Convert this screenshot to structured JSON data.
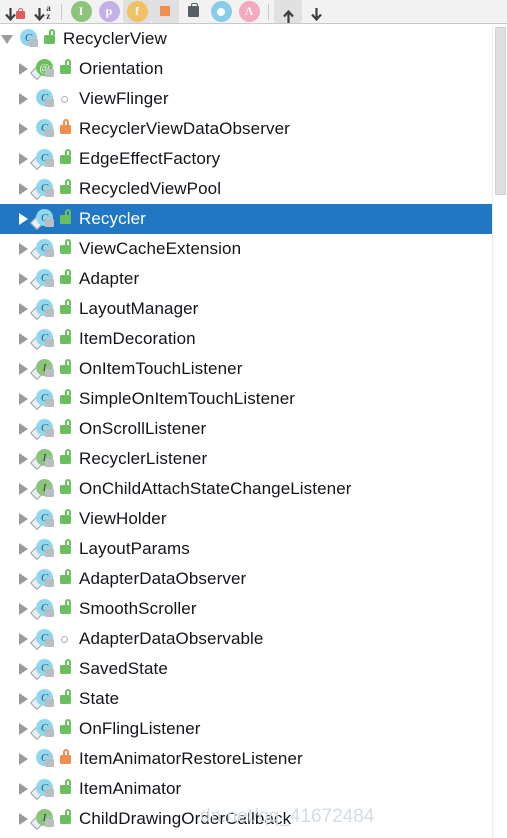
{
  "toolbar": {
    "buttons": [
      {
        "name": "sort-by-visibility-button",
        "icon": "arrow-down-lock-icon",
        "glyph": "lock",
        "pressed": false
      },
      {
        "name": "sort-alphabetically-button",
        "icon": "arrow-down-az-icon",
        "glyph": "az",
        "pressed": false
      },
      {
        "name": "show-inherited-button",
        "icon": "inherited-members-icon",
        "glyph": "I",
        "color": "#8cc47c",
        "pressed": false
      },
      {
        "name": "show-properties-button",
        "icon": "properties-icon",
        "glyph": "p",
        "color": "#c3b0e8",
        "pressed": false
      },
      {
        "name": "show-fields-button",
        "icon": "fields-icon",
        "glyph": "f",
        "color": "#f0c064",
        "pressed": true
      },
      {
        "name": "show-constants-button",
        "icon": "constants-icon",
        "glyph": "square",
        "color": "#ef8e4e",
        "pressed": true
      },
      {
        "name": "show-non-public-button",
        "icon": "briefcase-icon",
        "glyph": "briefcase",
        "pressed": false
      },
      {
        "name": "group-methods-button",
        "icon": "circle-o-icon",
        "glyph": "O",
        "color": "#87cde8",
        "pressed": false
      },
      {
        "name": "show-anonymous-button",
        "icon": "lambda-icon",
        "glyph": "Λ",
        "color": "#f3aabc",
        "pressed": false
      },
      {
        "name": "expand-all-button",
        "icon": "arrow-up-icon",
        "glyph": "up",
        "pressed": true
      },
      {
        "name": "collapse-all-button",
        "icon": "arrow-down-icon",
        "glyph": "down",
        "pressed": false
      }
    ]
  },
  "colors": {
    "selection": "#2277c4",
    "toolbar_bg": "#f2f2f2",
    "class_badge": "#8fd8ef",
    "interface_badge": "#8cc47c",
    "annotation_badge": "#6cbf5e",
    "protected_lock": "#6cbf5e",
    "private_lock": "#ef8e4e",
    "text": "#12141a"
  },
  "tree": {
    "nodes": [
      {
        "label": "RecyclerView",
        "kind": "class",
        "abstract": false,
        "visibility": "protected",
        "depth": 0,
        "expanded": true,
        "selected": false
      },
      {
        "label": "Orientation",
        "kind": "annotation",
        "abstract": true,
        "visibility": "protected",
        "depth": 1,
        "expanded": false,
        "selected": false
      },
      {
        "label": "ViewFlinger",
        "kind": "class",
        "abstract": false,
        "visibility": "package",
        "depth": 1,
        "expanded": false,
        "selected": false
      },
      {
        "label": "RecyclerViewDataObserver",
        "kind": "class",
        "abstract": false,
        "visibility": "private",
        "depth": 1,
        "expanded": false,
        "selected": false
      },
      {
        "label": "EdgeEffectFactory",
        "kind": "class",
        "abstract": true,
        "visibility": "protected",
        "depth": 1,
        "expanded": false,
        "selected": false
      },
      {
        "label": "RecycledViewPool",
        "kind": "class",
        "abstract": true,
        "visibility": "protected",
        "depth": 1,
        "expanded": false,
        "selected": false
      },
      {
        "label": "Recycler",
        "kind": "class",
        "abstract": true,
        "visibility": "protected",
        "depth": 1,
        "expanded": false,
        "selected": true
      },
      {
        "label": "ViewCacheExtension",
        "kind": "class",
        "abstract": true,
        "visibility": "protected",
        "depth": 1,
        "expanded": false,
        "selected": false
      },
      {
        "label": "Adapter",
        "kind": "class",
        "abstract": true,
        "visibility": "protected",
        "depth": 1,
        "expanded": false,
        "selected": false
      },
      {
        "label": "LayoutManager",
        "kind": "class",
        "abstract": true,
        "visibility": "protected",
        "depth": 1,
        "expanded": false,
        "selected": false
      },
      {
        "label": "ItemDecoration",
        "kind": "class",
        "abstract": true,
        "visibility": "protected",
        "depth": 1,
        "expanded": false,
        "selected": false
      },
      {
        "label": "OnItemTouchListener",
        "kind": "interface",
        "abstract": true,
        "visibility": "protected",
        "depth": 1,
        "expanded": false,
        "selected": false
      },
      {
        "label": "SimpleOnItemTouchListener",
        "kind": "class",
        "abstract": true,
        "visibility": "protected",
        "depth": 1,
        "expanded": false,
        "selected": false
      },
      {
        "label": "OnScrollListener",
        "kind": "class",
        "abstract": true,
        "visibility": "protected",
        "depth": 1,
        "expanded": false,
        "selected": false
      },
      {
        "label": "RecyclerListener",
        "kind": "interface",
        "abstract": true,
        "visibility": "protected",
        "depth": 1,
        "expanded": false,
        "selected": false
      },
      {
        "label": "OnChildAttachStateChangeListener",
        "kind": "interface",
        "abstract": true,
        "visibility": "protected",
        "depth": 1,
        "expanded": false,
        "selected": false
      },
      {
        "label": "ViewHolder",
        "kind": "class",
        "abstract": true,
        "visibility": "protected",
        "depth": 1,
        "expanded": false,
        "selected": false
      },
      {
        "label": "LayoutParams",
        "kind": "class",
        "abstract": true,
        "visibility": "protected",
        "depth": 1,
        "expanded": false,
        "selected": false
      },
      {
        "label": "AdapterDataObserver",
        "kind": "class",
        "abstract": true,
        "visibility": "protected",
        "depth": 1,
        "expanded": false,
        "selected": false
      },
      {
        "label": "SmoothScroller",
        "kind": "class",
        "abstract": true,
        "visibility": "protected",
        "depth": 1,
        "expanded": false,
        "selected": false
      },
      {
        "label": "AdapterDataObservable",
        "kind": "class",
        "abstract": true,
        "visibility": "package",
        "depth": 1,
        "expanded": false,
        "selected": false
      },
      {
        "label": "SavedState",
        "kind": "class",
        "abstract": true,
        "visibility": "protected",
        "depth": 1,
        "expanded": false,
        "selected": false
      },
      {
        "label": "State",
        "kind": "class",
        "abstract": true,
        "visibility": "protected",
        "depth": 1,
        "expanded": false,
        "selected": false
      },
      {
        "label": "OnFlingListener",
        "kind": "class",
        "abstract": true,
        "visibility": "protected",
        "depth": 1,
        "expanded": false,
        "selected": false
      },
      {
        "label": "ItemAnimatorRestoreListener",
        "kind": "class",
        "abstract": false,
        "visibility": "private",
        "depth": 1,
        "expanded": false,
        "selected": false
      },
      {
        "label": "ItemAnimator",
        "kind": "class",
        "abstract": true,
        "visibility": "protected",
        "depth": 1,
        "expanded": false,
        "selected": false
      },
      {
        "label": "ChildDrawingOrderCallback",
        "kind": "interface",
        "abstract": true,
        "visibility": "protected",
        "depth": 1,
        "expanded": false,
        "selected": false
      }
    ]
  },
  "watermark": {
    "text": "dn.net/qq_41672484"
  }
}
